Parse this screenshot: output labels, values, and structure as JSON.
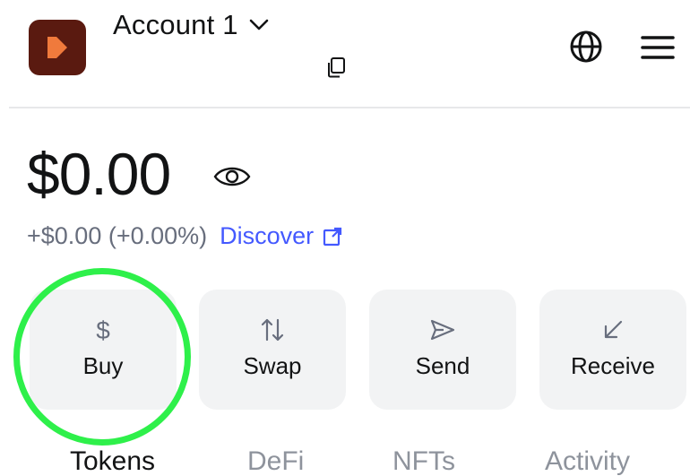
{
  "header": {
    "account_name": "Account 1",
    "avatar_color": "#5a1a10",
    "avatar_accent": "#f07a3c",
    "icons": [
      "chevron-down-icon",
      "copy-icon",
      "globe-icon",
      "menu-icon"
    ]
  },
  "balance": {
    "amount": "$0.00",
    "change": "+$0.00 (+0.00%)",
    "discover_label": "Discover",
    "link_color": "#4459ff"
  },
  "actions": [
    {
      "label": "Buy",
      "icon": "dollar-icon"
    },
    {
      "label": "Swap",
      "icon": "swap-arrows-icon"
    },
    {
      "label": "Send",
      "icon": "send-icon"
    },
    {
      "label": "Receive",
      "icon": "receive-arrow-icon"
    }
  ],
  "highlight_color": "#2ef04a",
  "tabs": [
    {
      "label": "Tokens",
      "active": true
    },
    {
      "label": "DeFi",
      "active": false
    },
    {
      "label": "NFTs",
      "active": false
    },
    {
      "label": "Activity",
      "active": false
    }
  ]
}
